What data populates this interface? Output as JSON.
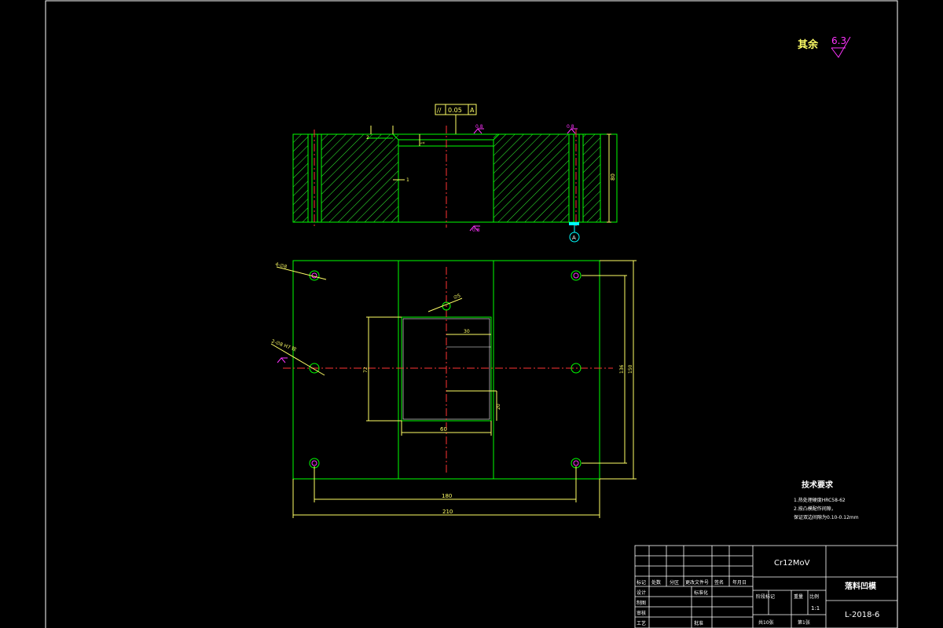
{
  "roughness_note": {
    "prefix": "其余",
    "value": "6.3"
  },
  "tolerance_frame": {
    "symbol": "//",
    "value": "0.05",
    "datum": "A"
  },
  "section_view": {
    "datum_label": "A",
    "labels": {
      "dim_depth": "80",
      "chamfer_small": "1",
      "rough_top_left": "0.8",
      "rough_top_right": "0.8",
      "rough_bottom": "0.8",
      "counterbore": "2"
    }
  },
  "plan_view": {
    "callouts": {
      "top_left_holes": "4-∅8",
      "mid_left_holes": "2-∅8 H7 铰",
      "center_hole": "∅5"
    },
    "dims": {
      "hole_span_x": "180",
      "overall_x": "210",
      "cavity_width": "60",
      "cavity_height": "72",
      "inner_width": "30",
      "inner_height": "20",
      "hole_span_y": "136",
      "overall_y": "150"
    }
  },
  "tech_requirements": {
    "title": "技术要求",
    "items": [
      "1.热处理硬度HRC58-62",
      "2.按凸模配作间隙，",
      "保证双边间隙为0.10-0.12mm"
    ]
  },
  "title_block": {
    "material": "Cr12MoV",
    "part_name": "落料凹模",
    "drawing_no": "L-2018-6",
    "scale": "1:1",
    "sheets_total": "共10张",
    "sheet_no": "第1张",
    "headers": {
      "mark": "标记",
      "count": "处数",
      "zone": "分区",
      "change_doc": "更改文件号",
      "sign": "签名",
      "date": "年月日",
      "design": "设计",
      "standardize": "标准化",
      "draw": "制图",
      "review": "审核",
      "process": "工艺",
      "approve": "批准",
      "stage_mark": "阶段标记",
      "weight": "重量",
      "scale_label": "比例"
    }
  },
  "colors": {
    "outline": "#00ff00",
    "center": "#ff3333",
    "dim": "#ffff66",
    "hatch": "#33ff33",
    "symbol": "#ff33ff",
    "frame": "#ffffff",
    "datum": "#00ffff"
  }
}
